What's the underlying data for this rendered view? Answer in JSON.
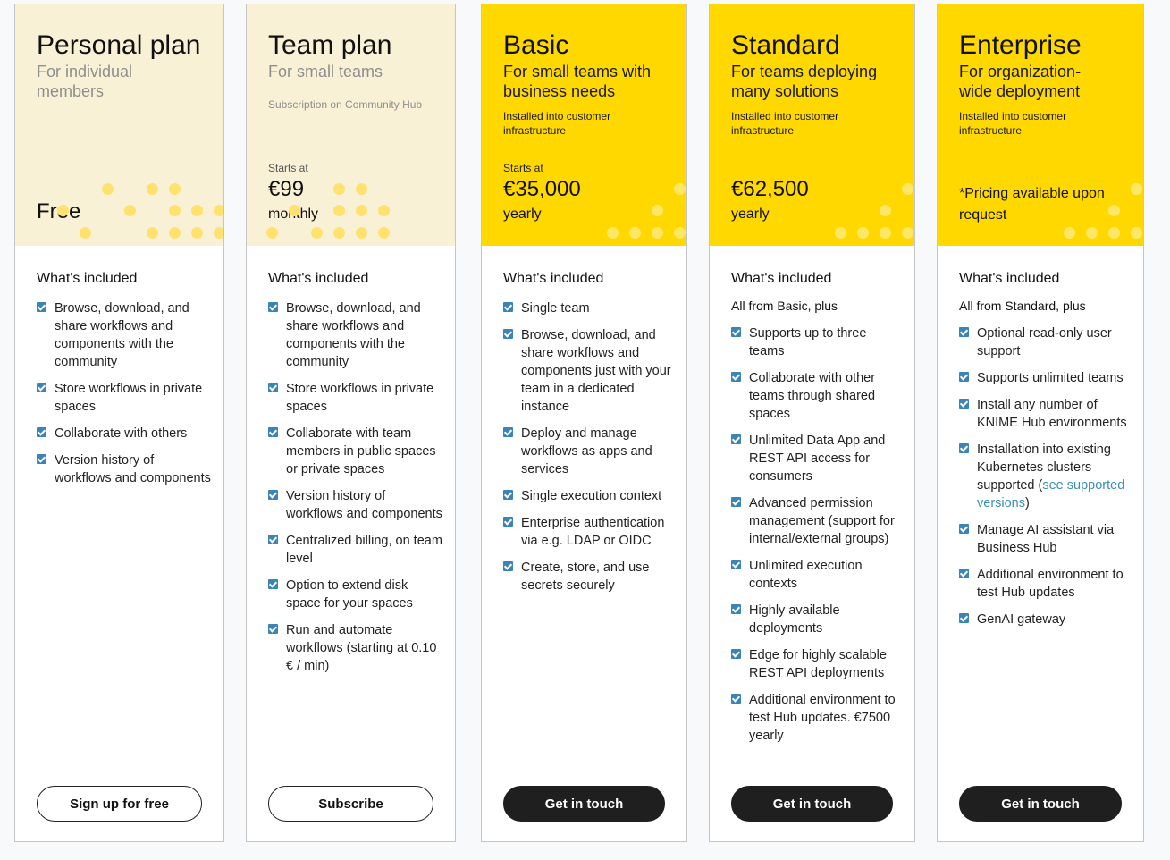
{
  "plans": [
    {
      "title": "Personal plan",
      "subtitle": "For individual members",
      "price_text": "Free",
      "included_heading": "What's included",
      "features": [
        "Browse, download, and share workflows and components with the community",
        "Store workflows in private spaces",
        "Collaborate with others",
        "Version history of workflows and components"
      ],
      "button": "Sign up for free"
    },
    {
      "title": "Team plan",
      "subtitle": "For small teams",
      "note": "Subscription on Community Hub",
      "starts_at": "Starts at",
      "price": "€99",
      "period": "monthly",
      "included_heading": "What's included",
      "features": [
        "Browse, download, and share workflows and components with the community",
        "Store workflows in private spaces",
        "Collaborate with team members in public spaces or private spaces",
        "Version history of workflows and components",
        "Centralized billing, on team level",
        "Option to extend disk space for your spaces",
        "Run and automate workflows (starting at 0.10 € / min)"
      ],
      "button": "Subscribe"
    },
    {
      "title": "Basic",
      "subtitle": "For small teams with business needs",
      "note": "Installed into customer infrastructure",
      "starts_at": "Starts at",
      "price": "€35,000",
      "period": "yearly",
      "included_heading": "What's included",
      "features": [
        "Single team",
        "Browse, download, and share workflows and components just with your team in a dedicated instance",
        "Deploy and manage workflows as apps and services",
        "Single execution context",
        "Enterprise authentication via e.g. LDAP or OIDC",
        "Create, store, and use secrets securely"
      ],
      "button": "Get in touch"
    },
    {
      "title": "Standard",
      "subtitle": "For teams deploying many solutions",
      "note": "Installed into customer infrastructure",
      "price": "€62,500",
      "period": "yearly",
      "included_heading": "What's included",
      "lead": "All from Basic, plus",
      "features": [
        "Supports up to three teams",
        "Collaborate with other teams through shared spaces",
        "Unlimited Data App and REST API access for consumers",
        "Advanced permission management (support for internal/external groups)",
        "Unlimited execution contexts",
        "Highly available deployments",
        "Edge for highly scalable REST API deployments",
        "Additional environment to test Hub updates. €7500 yearly"
      ],
      "button": "Get in touch"
    },
    {
      "title": "Enterprise",
      "subtitle": "For organization-wide deployment",
      "note": "Installed into customer infrastructure",
      "pricing_note": "*Pricing available upon request",
      "included_heading": "What's included",
      "lead": "All from Standard, plus",
      "features": [
        "Optional read-only user support",
        "Supports unlimited teams",
        "Install any number of KNIME Hub environments",
        "Manage AI assistant via Business Hub",
        "Additional environment to test Hub updates",
        "GenAI gateway"
      ],
      "special_feature": {
        "before": "Installation into existing Kubernetes clusters supported (",
        "link": "see supported versions",
        "after": ")"
      },
      "button": "Get in touch"
    }
  ],
  "colors": {
    "cream_header": "#f8f1d6",
    "yellow_header": "#ffd800",
    "checkbox": "#3a84b8",
    "link": "#3a8fb7",
    "dark_button": "#1f1f1f"
  }
}
